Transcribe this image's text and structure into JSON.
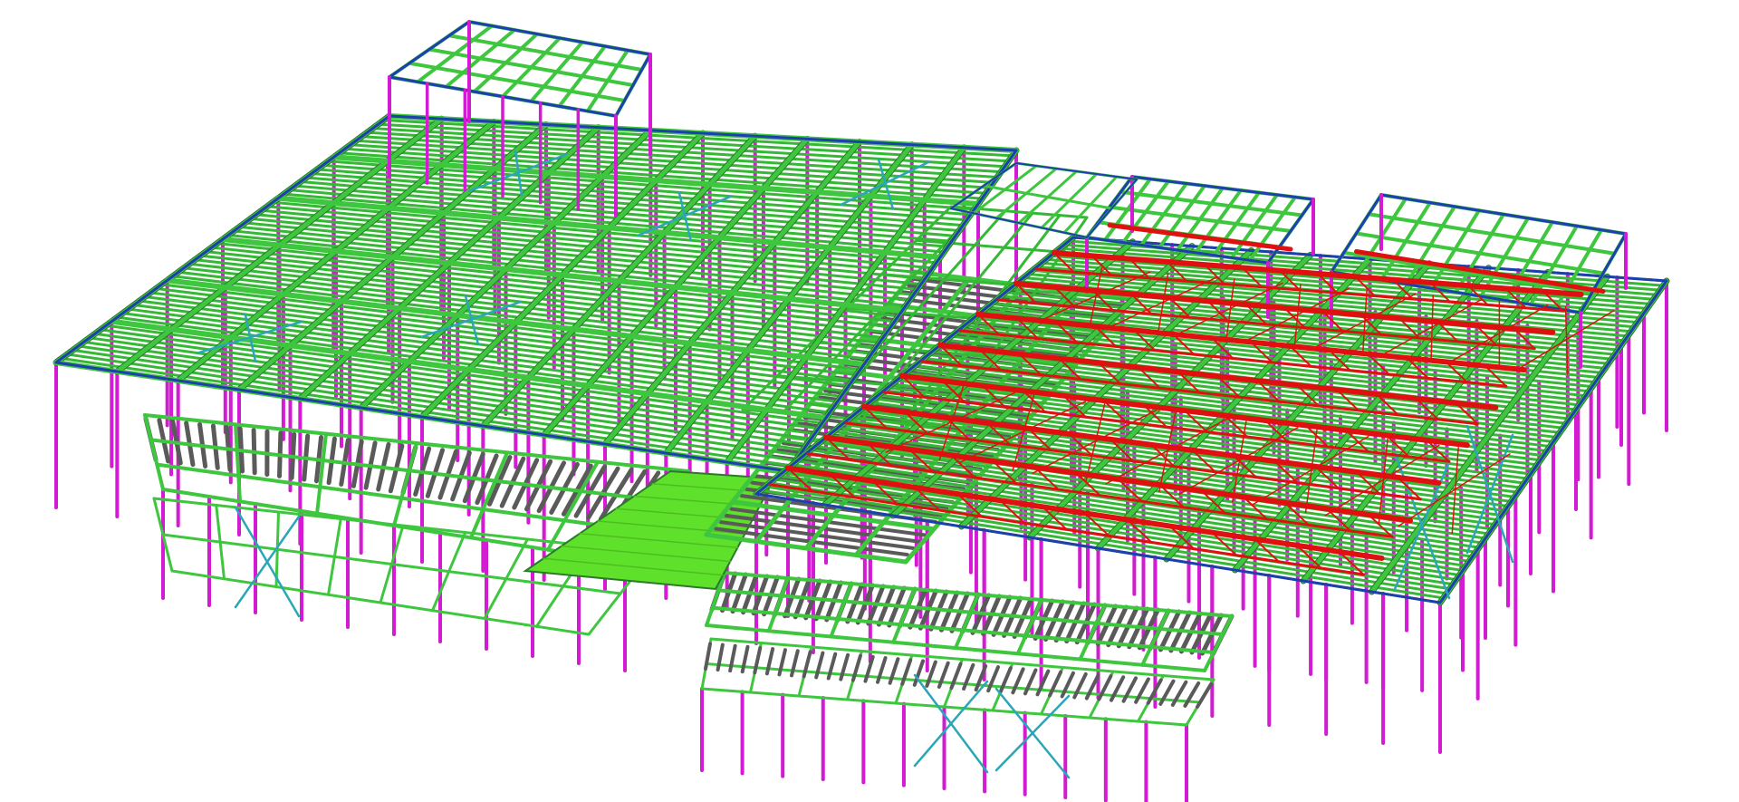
{
  "scene": {
    "background": "#ffffff",
    "members": {
      "columns": {
        "color": "#d21bd2"
      },
      "beams": {
        "color": "#3fc63f",
        "edge": "#2b7a2b"
      },
      "rafters": {
        "color": "#35b835"
      },
      "bracing": {
        "color": "#2aa6b8"
      },
      "perimeter_edge": {
        "color": "#1e3fae"
      },
      "trusses": {
        "color": "#e01010"
      },
      "deck_joists": {
        "color": "#5a5a5a"
      },
      "solid_deck": {
        "color": "#5fe02a"
      }
    }
  }
}
